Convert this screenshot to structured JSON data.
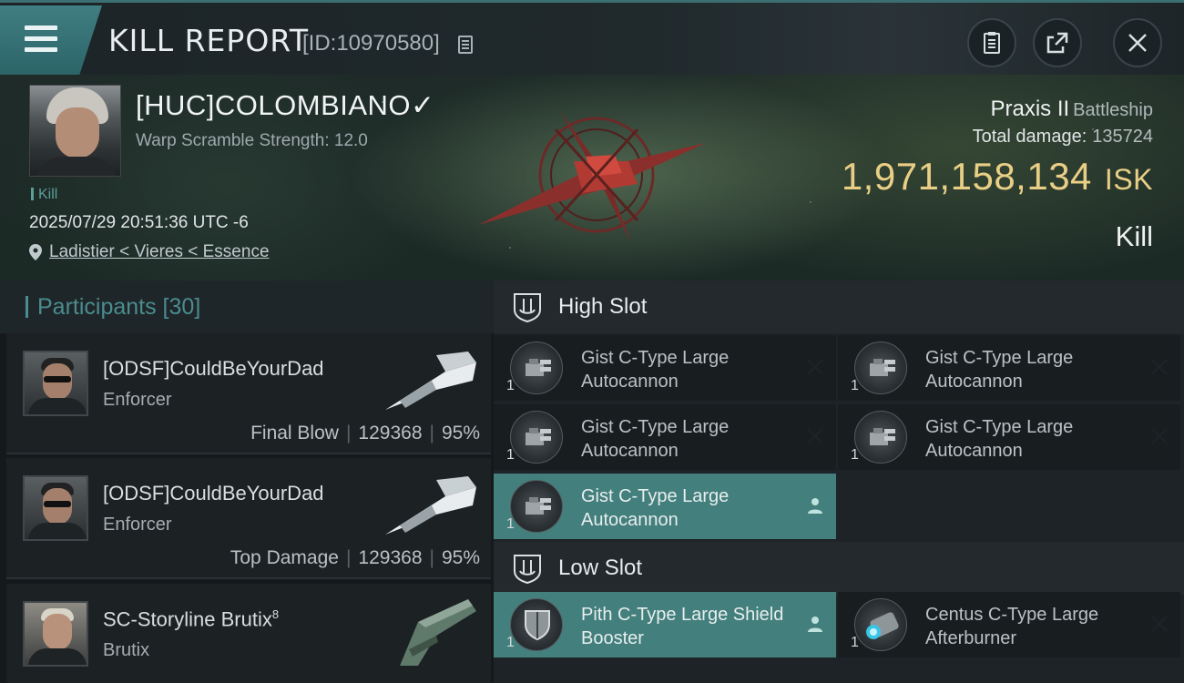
{
  "header": {
    "title": "KILL REPORT",
    "report_id": "[ID:10970580]"
  },
  "victim": {
    "name": "[HUC]COLOMBIANO✓",
    "warp_scramble": "Warp Scramble Strength: 12.0",
    "kill_tag": "Kill",
    "timestamp": "2025/07/29 20:51:36 UTC -6",
    "location": "Ladistier < Vieres < Essence"
  },
  "ship": {
    "name": "Praxis II",
    "class": "Battleship",
    "total_damage_label": "Total damage:",
    "total_damage": "135724",
    "isk_value": "1,971,158,134",
    "isk_unit": "ISK",
    "result": "Kill"
  },
  "participants": {
    "header": "Participants [30]",
    "items": [
      {
        "name": "[ODSF]CouldBeYourDad",
        "ship": "Enforcer",
        "role": "Final Blow",
        "damage": "129368",
        "percent": "95%"
      },
      {
        "name": "[ODSF]CouldBeYourDad",
        "ship": "Enforcer",
        "role": "Top Damage",
        "damage": "129368",
        "percent": "95%"
      },
      {
        "name": "SC-Storyline Brutix",
        "name_sup": "8",
        "ship": "Brutix"
      }
    ]
  },
  "fitting": {
    "high_slot_label": "High Slot",
    "low_slot_label": "Low Slot",
    "high": [
      {
        "name": "Gist C-Type Large Autocannon",
        "qty": "1",
        "status": "destroyed-icon"
      },
      {
        "name": "Gist C-Type Large Autocannon",
        "qty": "1",
        "status": "destroyed-icon"
      },
      {
        "name": "Gist C-Type Large Autocannon",
        "qty": "1",
        "status": "destroyed-icon"
      },
      {
        "name": "Gist C-Type Large Autocannon",
        "qty": "1",
        "status": "destroyed-icon"
      },
      {
        "name": "Gist C-Type Large Autocannon",
        "qty": "1",
        "status": "dropped-icon"
      }
    ],
    "low": [
      {
        "name": "Pith C-Type Large Shield Booster",
        "qty": "1",
        "status": "dropped-icon"
      },
      {
        "name": "Centus C-Type Large Afterburner",
        "qty": "1",
        "status": "destroyed-icon"
      }
    ]
  },
  "colors": {
    "accent": "#4a8c8f",
    "isk": "#e9cf86",
    "highlight_row": "#437f7c"
  }
}
